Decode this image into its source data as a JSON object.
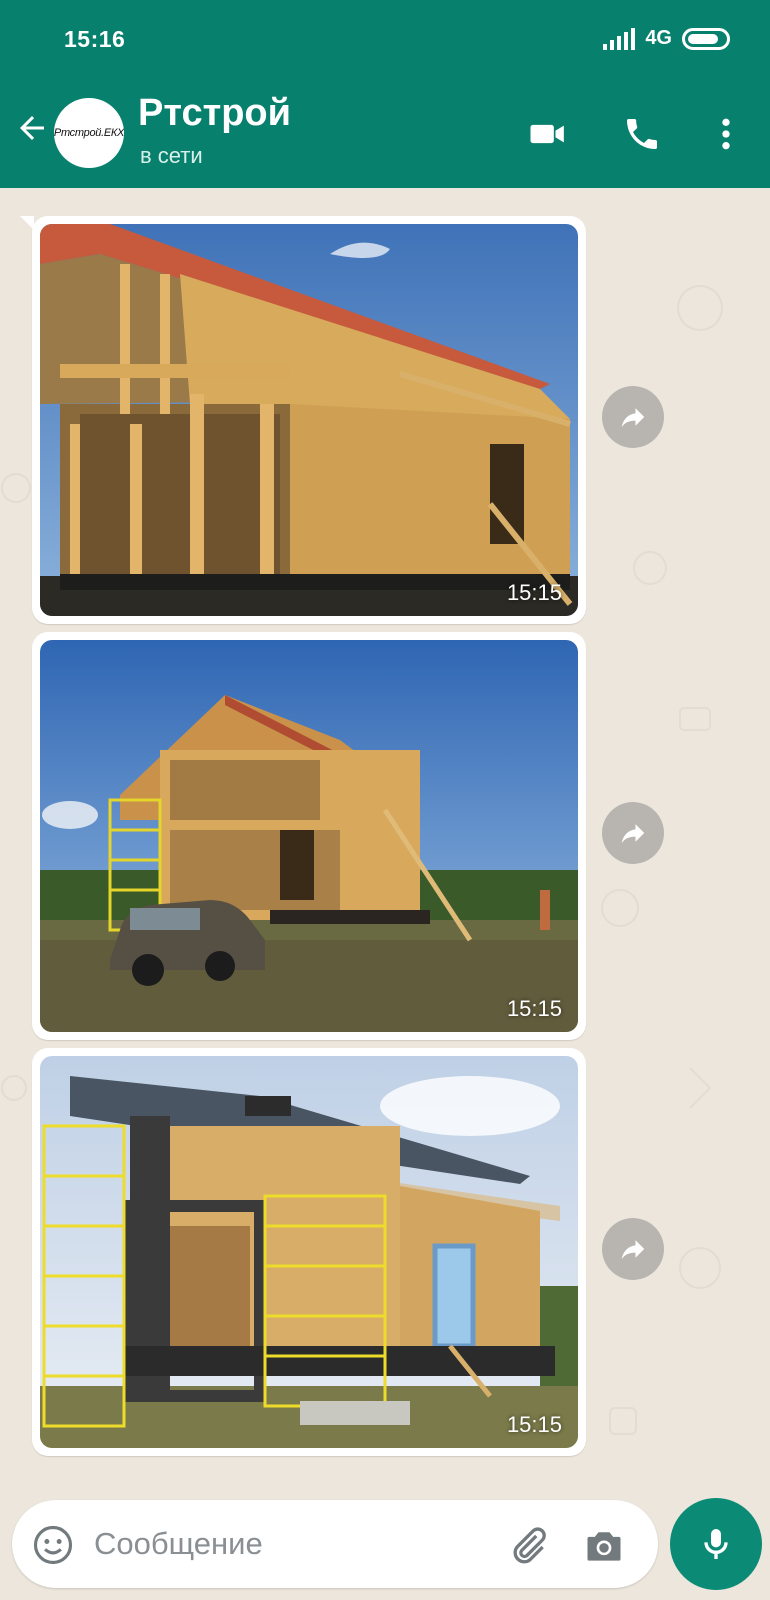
{
  "status": {
    "time": "15:16",
    "network": "4G"
  },
  "header": {
    "title": "Ртстрой",
    "subtitle": "в сети",
    "avatar_text": "Ртстрой.ЕКХ"
  },
  "messages": [
    {
      "type": "image",
      "timestamp": "15:15",
      "image_description": "SIP house under construction, upper floor framing"
    },
    {
      "type": "image",
      "timestamp": "15:15",
      "image_description": "SIP house with car parked in front"
    },
    {
      "type": "image",
      "timestamp": "15:15",
      "image_description": "Finished roof house with yellow scaffolding"
    }
  ],
  "composer": {
    "placeholder": "Сообщение"
  },
  "colors": {
    "header": "#08806e",
    "chat_bg": "#ede6dc",
    "fab": "#0b8b75"
  }
}
